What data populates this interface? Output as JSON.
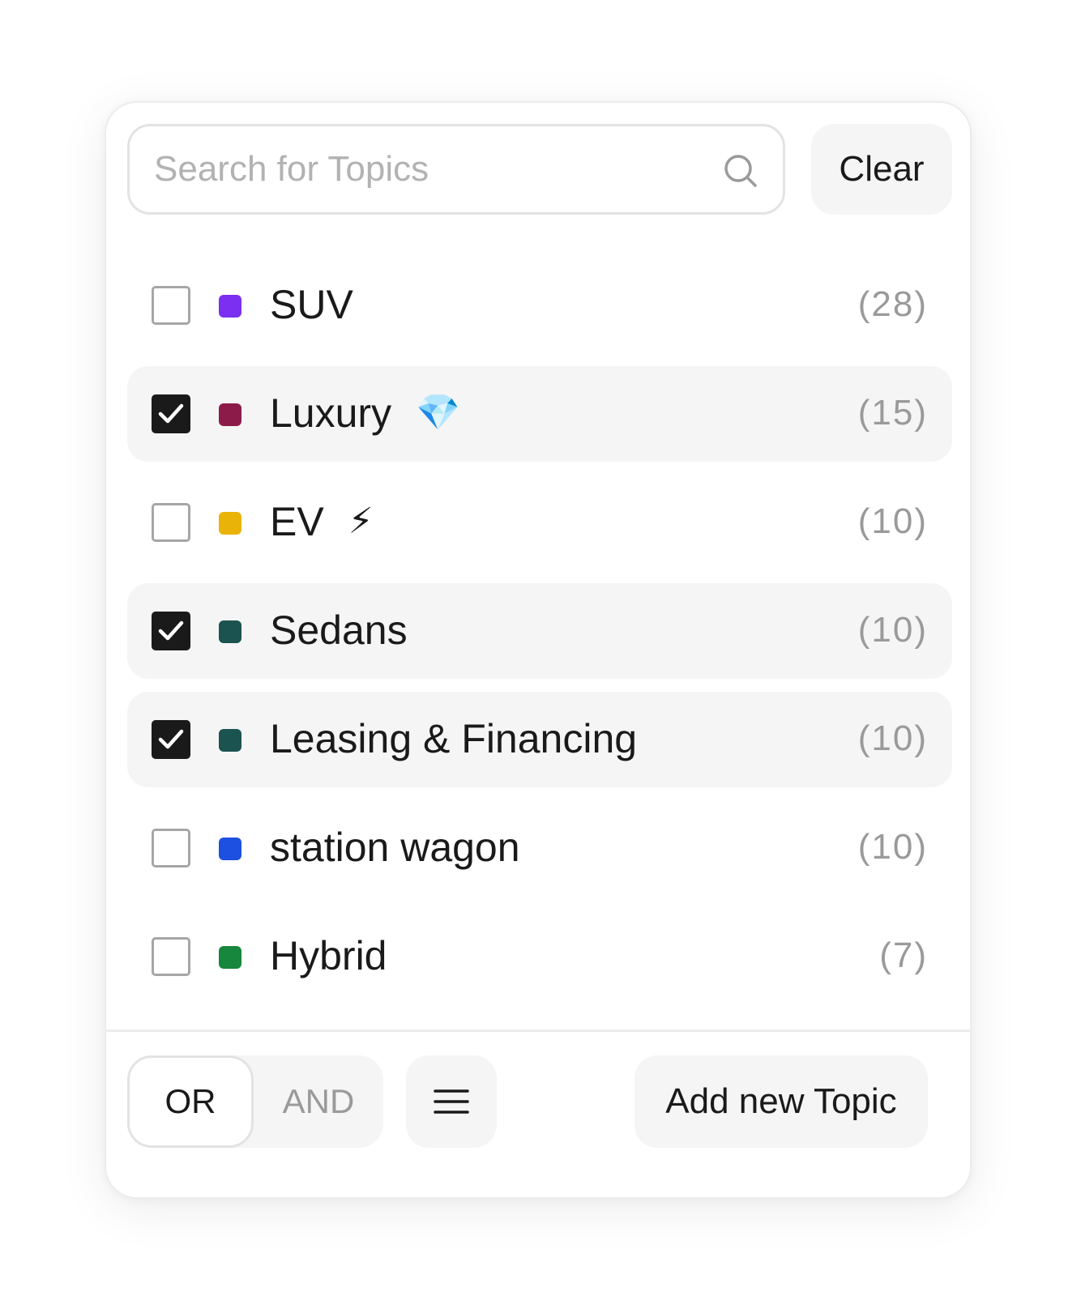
{
  "search": {
    "placeholder": "Search for Topics",
    "value": "",
    "icon": "search-icon"
  },
  "clear_label": "Clear",
  "topics": [
    {
      "label": "SUV",
      "emoji": "",
      "count": "(28)",
      "color": "#7b2ff0",
      "checked": false
    },
    {
      "label": "Luxury",
      "emoji": "💎",
      "count": "(15)",
      "color": "#8c1b4a",
      "checked": true
    },
    {
      "label": "EV",
      "emoji": "⚡",
      "count": "(10)",
      "color": "#eab308",
      "checked": false
    },
    {
      "label": "Sedans",
      "emoji": "",
      "count": "(10)",
      "color": "#1b5350",
      "checked": true
    },
    {
      "label": "Leasing & Financing",
      "emoji": "",
      "count": "(10)",
      "color": "#1b5350",
      "checked": true
    },
    {
      "label": "station wagon",
      "emoji": "",
      "count": "(10)",
      "color": "#1d4fe0",
      "checked": false
    },
    {
      "label": "Hybrid",
      "emoji": "",
      "count": "(7)",
      "color": "#16873d",
      "checked": false
    }
  ],
  "footer": {
    "mode_or": "OR",
    "mode_and": "AND",
    "active_mode": "OR",
    "menu_icon": "hamburger-menu-icon",
    "add_topic_label": "Add new Topic"
  }
}
